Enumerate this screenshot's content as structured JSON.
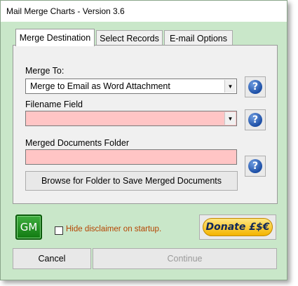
{
  "window": {
    "title": "Mail Merge Charts - Version 3.6"
  },
  "tabs": [
    {
      "label": "Merge Destination",
      "active": true
    },
    {
      "label": "Select Records",
      "active": false
    },
    {
      "label": "E-mail Options",
      "active": false
    }
  ],
  "merge_to": {
    "label": "Merge To:",
    "value": "Merge to Email as Word Attachment"
  },
  "filename_field": {
    "label": "Filename Field",
    "value": ""
  },
  "merged_folder": {
    "label": "Merged Documents Folder",
    "value": ""
  },
  "browse_button": "Browse for Folder to Save Merged Documents",
  "help_icon_glyph": "?",
  "gm_button": "GM",
  "disclaimer_checkbox": {
    "label": "Hide disclaimer on startup.",
    "checked": false
  },
  "donate_button": "Donate £$€",
  "cancel_button": "Cancel",
  "continue_button": "Continue",
  "colors": {
    "window_bg": "#c9e7c9",
    "required_field": "#ffc5c5",
    "gm_green": "#117a11",
    "donate_gold": "#f4b400",
    "checkbox_label": "#b54400"
  },
  "icons": {
    "help": "help-icon",
    "dropdown": "chevron-down-icon"
  }
}
